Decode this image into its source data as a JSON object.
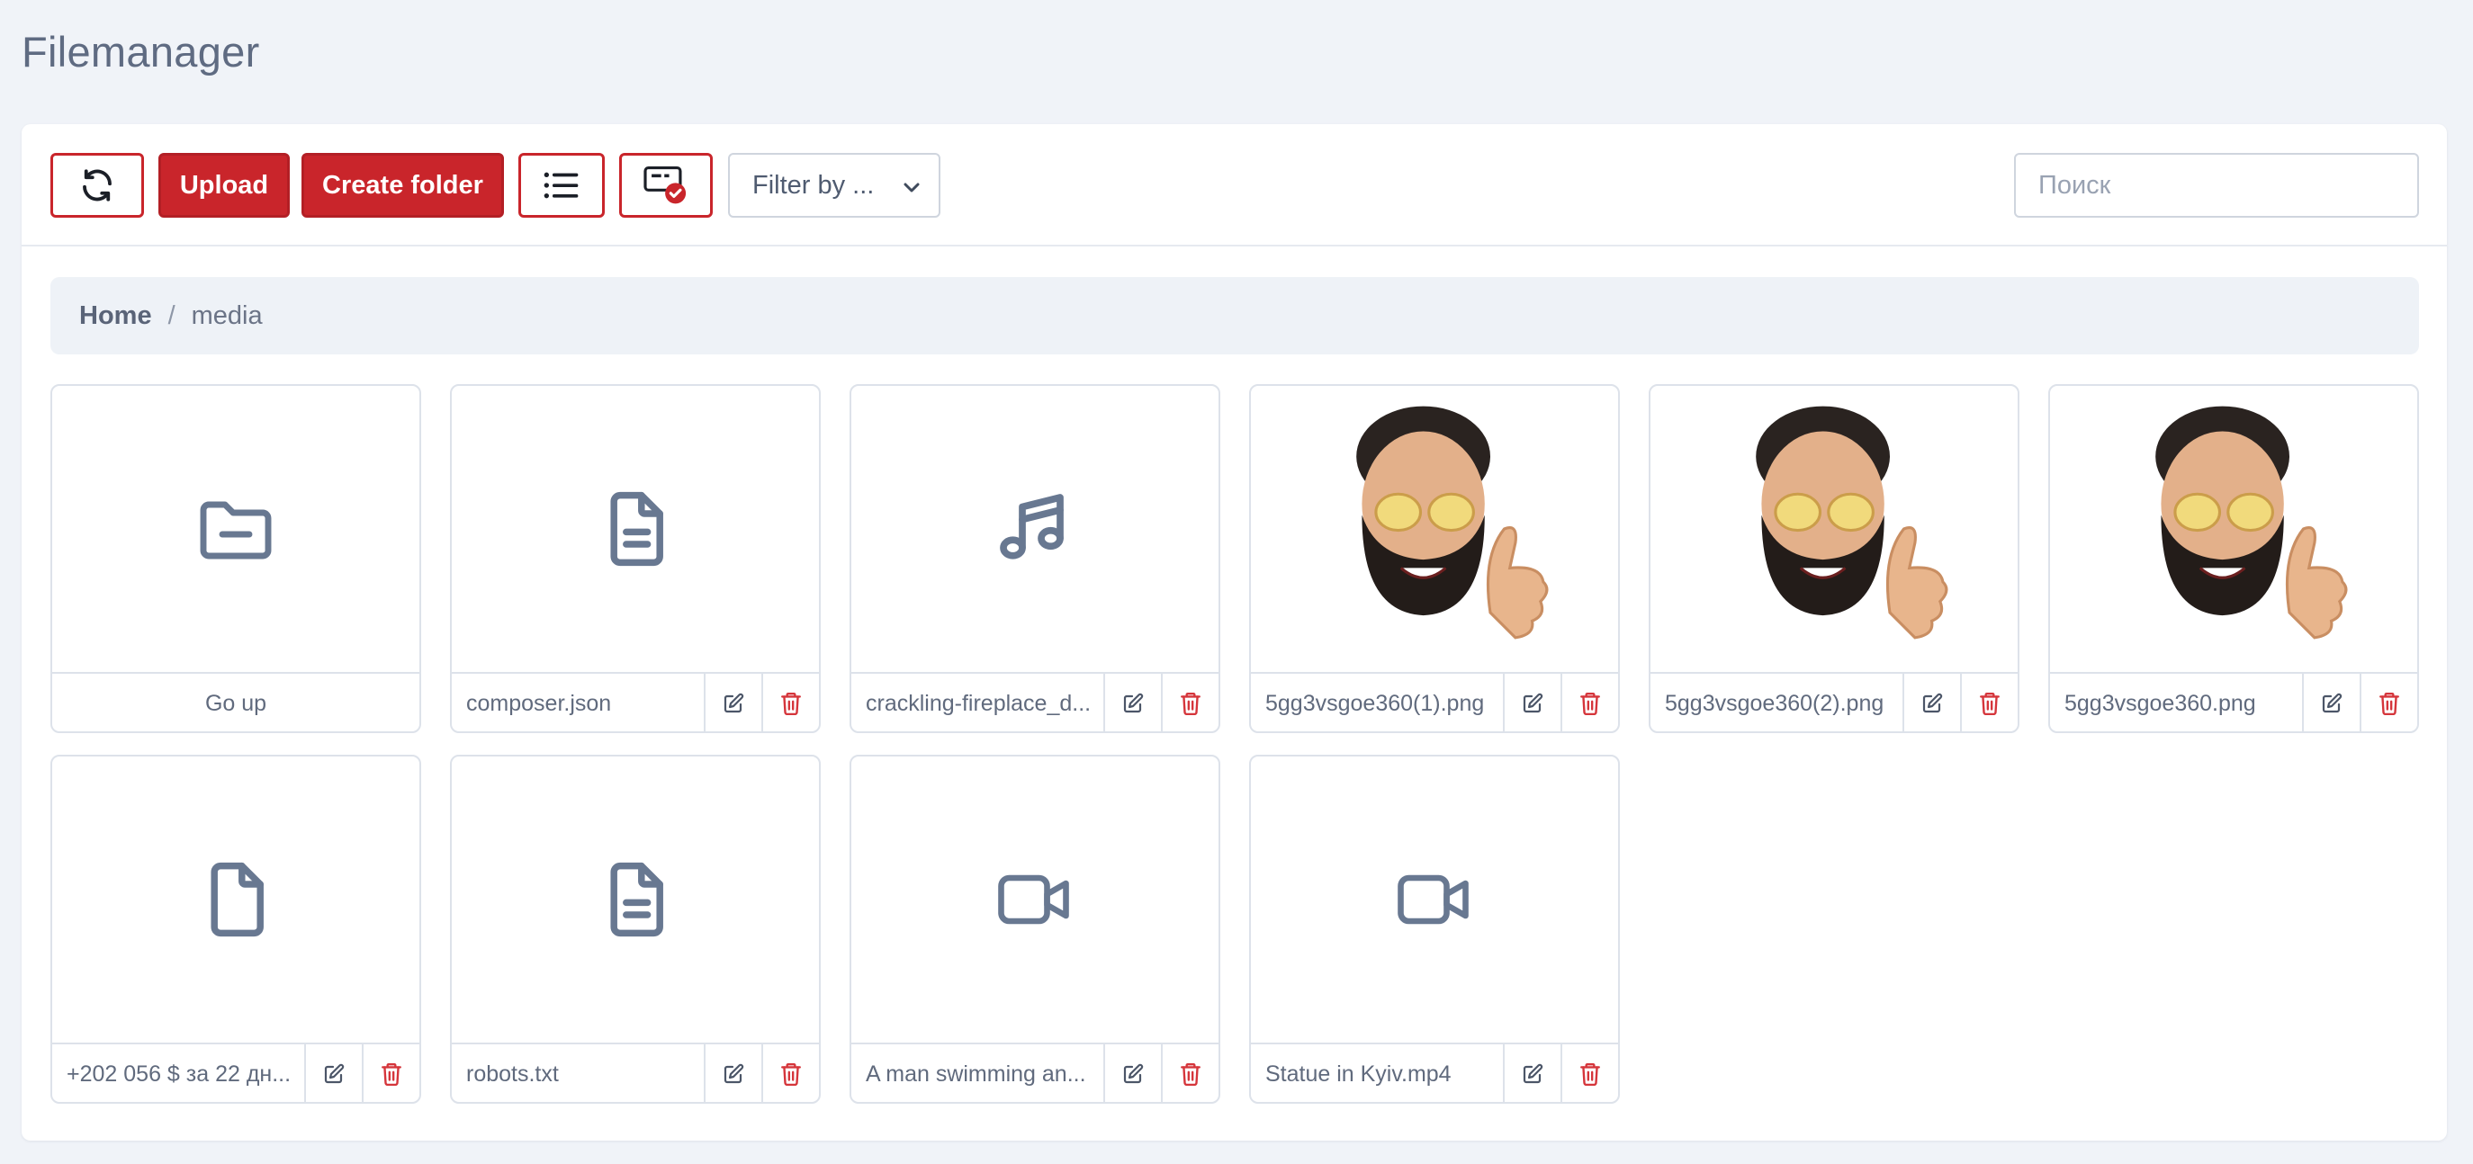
{
  "page_title": "Filemanager",
  "toolbar": {
    "upload_label": "Upload",
    "create_folder_label": "Create folder",
    "filter_label": "Filter by ...",
    "search_placeholder": "Поиск"
  },
  "breadcrumb": {
    "home": "Home",
    "separator": "/",
    "current": "media"
  },
  "colors": {
    "accent": "#c9252b",
    "icon": "#687891"
  },
  "files": [
    {
      "name": "Go up",
      "icon": "folder-up-icon",
      "actions": false
    },
    {
      "name": "composer.json",
      "icon": "file-text-icon",
      "actions": true
    },
    {
      "name": "crackling-fireplace_d...",
      "icon": "music-icon",
      "actions": true
    },
    {
      "name": "5gg3vsgoe360(1).png",
      "icon": "image-thumbnail",
      "actions": true
    },
    {
      "name": "5gg3vsgoe360(2).png",
      "icon": "image-thumbnail",
      "actions": true
    },
    {
      "name": "5gg3vsgoe360.png",
      "icon": "image-thumbnail",
      "actions": true
    },
    {
      "name": "+202 056 $ за 22 дн...",
      "icon": "file-icon",
      "actions": true
    },
    {
      "name": "robots.txt",
      "icon": "file-text-icon",
      "actions": true
    },
    {
      "name": "A man swimming an...",
      "icon": "video-icon",
      "actions": true
    },
    {
      "name": "Statue in Kyiv.mp4",
      "icon": "video-icon",
      "actions": true
    }
  ]
}
